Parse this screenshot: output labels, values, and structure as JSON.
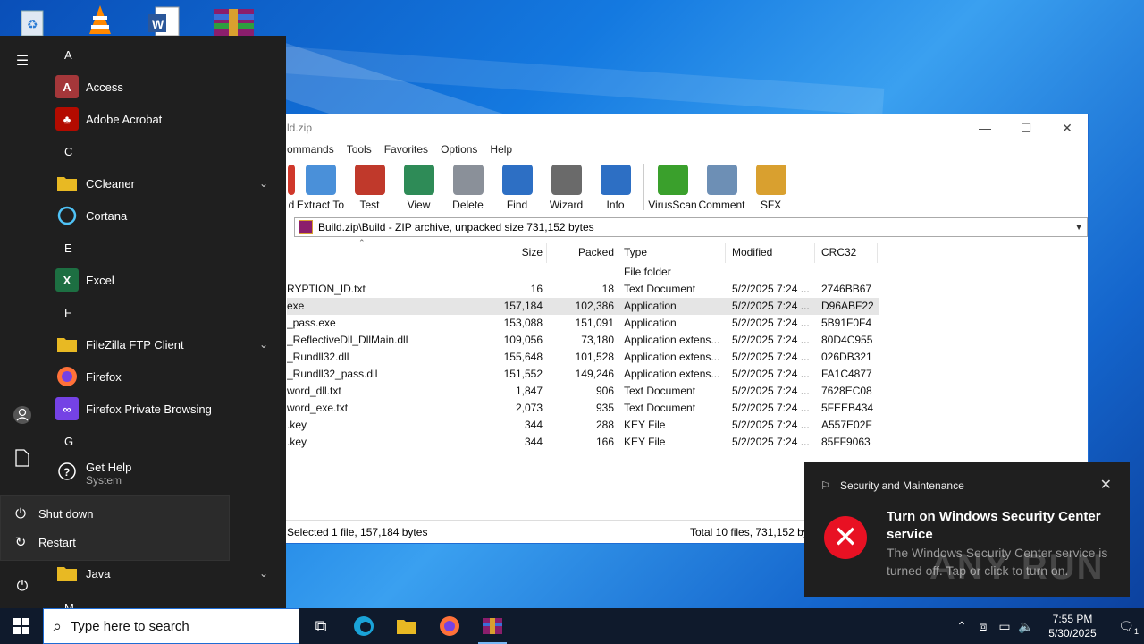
{
  "desktop": {
    "icons": [
      "recycle-bin-icon",
      "vlc-icon",
      "word-icon",
      "winrar-icon"
    ]
  },
  "winrar": {
    "title": "ld.zip",
    "menu": [
      "ommands",
      "Tools",
      "Favorites",
      "Options",
      "Help"
    ],
    "toolbar": [
      {
        "label": "d",
        "icon": "add-icon",
        "color": "#d0382b"
      },
      {
        "label": "Extract To",
        "icon": "extract-to-icon",
        "color": "#4a90d9"
      },
      {
        "label": "Test",
        "icon": "test-icon",
        "color": "#c0392b"
      },
      {
        "label": "View",
        "icon": "view-icon",
        "color": "#2e8b57"
      },
      {
        "label": "Delete",
        "icon": "delete-icon",
        "color": "#8a9099"
      },
      {
        "label": "Find",
        "icon": "find-icon",
        "color": "#2d6fc4"
      },
      {
        "label": "Wizard",
        "icon": "wizard-icon",
        "color": "#6a6a6a"
      },
      {
        "label": "Info",
        "icon": "info-icon",
        "color": "#2d6fc4"
      },
      {
        "label": "VirusScan",
        "icon": "virusscan-icon",
        "color": "#3aa02c"
      },
      {
        "label": "Comment",
        "icon": "comment-icon",
        "color": "#6d8fb5"
      },
      {
        "label": "SFX",
        "icon": "sfx-icon",
        "color": "#d9a02f"
      }
    ],
    "path": "Build.zip\\Build - ZIP archive, unpacked size 731,152 bytes",
    "columns": {
      "size": "Size",
      "packed": "Packed",
      "type": "Type",
      "modified": "Modified",
      "crc": "CRC32"
    },
    "rows": [
      {
        "name": "",
        "size": "",
        "packed": "",
        "type": "File folder",
        "modified": "",
        "crc": ""
      },
      {
        "name": "RYPTION_ID.txt",
        "size": "16",
        "packed": "18",
        "type": "Text Document",
        "modified": "5/2/2025 7:24 ...",
        "crc": "2746BB67"
      },
      {
        "name": "exe",
        "size": "157,184",
        "packed": "102,386",
        "type": "Application",
        "modified": "5/2/2025 7:24 ...",
        "crc": "D96ABF22"
      },
      {
        "name": "_pass.exe",
        "size": "153,088",
        "packed": "151,091",
        "type": "Application",
        "modified": "5/2/2025 7:24 ...",
        "crc": "5B91F0F4"
      },
      {
        "name": "_ReflectiveDll_DllMain.dll",
        "size": "109,056",
        "packed": "73,180",
        "type": "Application extens...",
        "modified": "5/2/2025 7:24 ...",
        "crc": "80D4C955"
      },
      {
        "name": "_Rundll32.dll",
        "size": "155,648",
        "packed": "101,528",
        "type": "Application extens...",
        "modified": "5/2/2025 7:24 ...",
        "crc": "026DB321"
      },
      {
        "name": "_Rundll32_pass.dll",
        "size": "151,552",
        "packed": "149,246",
        "type": "Application extens...",
        "modified": "5/2/2025 7:24 ...",
        "crc": "FA1C4877"
      },
      {
        "name": "word_dll.txt",
        "size": "1,847",
        "packed": "906",
        "type": "Text Document",
        "modified": "5/2/2025 7:24 ...",
        "crc": "7628EC08"
      },
      {
        "name": "word_exe.txt",
        "size": "2,073",
        "packed": "935",
        "type": "Text Document",
        "modified": "5/2/2025 7:24 ...",
        "crc": "5FEEB434"
      },
      {
        "name": ".key",
        "size": "344",
        "packed": "288",
        "type": "KEY File",
        "modified": "5/2/2025 7:24 ...",
        "crc": "A557E02F"
      },
      {
        "name": ".key",
        "size": "344",
        "packed": "166",
        "type": "KEY File",
        "modified": "5/2/2025 7:24 ...",
        "crc": "85FF9063"
      }
    ],
    "status_left": "Selected 1 file, 157,184 bytes",
    "status_right": "Total 10 files, 731,152 byt"
  },
  "start_menu": {
    "groups": [
      {
        "letter": "A",
        "apps": [
          {
            "name": "Access",
            "icon": "access-icon",
            "color": "#a4373a",
            "glyph": "A"
          },
          {
            "name": "Adobe Acrobat",
            "icon": "acrobat-icon",
            "color": "#b30b00",
            "glyph": "♣"
          }
        ]
      },
      {
        "letter": "C",
        "apps": [
          {
            "name": "CCleaner",
            "icon": "folder-icon",
            "color": "#e8b923",
            "glyph": "",
            "expand": "⌄"
          },
          {
            "name": "Cortana",
            "icon": "cortana-icon",
            "color": "",
            "glyph": "○"
          }
        ]
      },
      {
        "letter": "E",
        "apps": [
          {
            "name": "Excel",
            "icon": "excel-icon",
            "color": "#1d6f42",
            "glyph": "X"
          }
        ]
      },
      {
        "letter": "F",
        "apps": [
          {
            "name": "FileZilla FTP Client",
            "icon": "folder-icon",
            "color": "#e8b923",
            "glyph": "",
            "expand": "⌄"
          },
          {
            "name": "Firefox",
            "icon": "firefox-icon",
            "color": "#ff7139",
            "glyph": ""
          },
          {
            "name": "Firefox Private Browsing",
            "icon": "firefox-private-icon",
            "color": "#7542e5",
            "glyph": "∞"
          }
        ]
      },
      {
        "letter": "G",
        "apps": [
          {
            "name": "Get Help",
            "sub": "System",
            "icon": "get-help-icon",
            "color": "",
            "glyph": "?"
          }
        ]
      }
    ],
    "power": [
      {
        "label": "Shut down",
        "icon": "power-icon",
        "glyph": "⏻"
      },
      {
        "label": "Restart",
        "icon": "restart-icon",
        "glyph": "↻"
      }
    ],
    "java": {
      "name": "Java",
      "expand": "⌄"
    },
    "next_letter": "M"
  },
  "toast": {
    "app": "Security and Maintenance",
    "title": "Turn on Windows Security Center service",
    "body": "The Windows Security Center service is turned off. Tap or click to turn on."
  },
  "watermark": "ANY RUN",
  "taskbar": {
    "search_placeholder": "Type here to search",
    "time": "7:55 PM",
    "date": "5/30/2025",
    "notification_count": "1"
  }
}
